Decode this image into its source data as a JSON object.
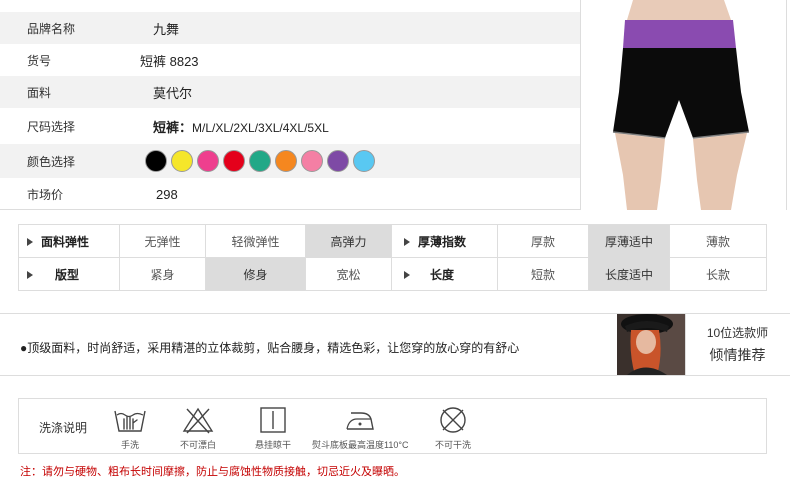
{
  "product": {
    "rows": [
      {
        "label": "品牌名称",
        "value": "九舞"
      },
      {
        "label": "货号",
        "value": "短裤 8823"
      },
      {
        "label": "面料",
        "value": "莫代尔"
      },
      {
        "label": "尺码选择",
        "size_prefix": "短裤：",
        "size_list": "M/L/XL/2XL/3XL/4XL/5XL"
      },
      {
        "label": "颜色选择"
      },
      {
        "label": "市场价",
        "value": "298"
      }
    ],
    "colors": [
      "#000000",
      "#f5e62a",
      "#ee3f8e",
      "#e4001b",
      "#22a887",
      "#f5871f",
      "#f47fa4",
      "#7e4aa5",
      "#59c8f2"
    ]
  },
  "attributes": {
    "row1": {
      "elastic_head": "面料弹性",
      "elastic_options": [
        "无弹性",
        "轻微弹性",
        "高弹力"
      ],
      "elastic_selected": 2,
      "thickness_head": "厚薄指数",
      "thickness_options": [
        "厚款",
        "厚薄适中",
        "薄款"
      ],
      "thickness_selected": 1
    },
    "row2": {
      "fit_head": "版型",
      "fit_options": [
        "紧身",
        "修身",
        "宽松"
      ],
      "fit_selected": 1,
      "length_head": "长度",
      "length_options": [
        "短款",
        "长度适中",
        "长款"
      ],
      "length_selected": 1
    }
  },
  "band": {
    "slogan": "●顶级面料，时尚舒适，采用精湛的立体裁剪，贴合腰身，精选色彩，让您穿的放心穿的有舒心",
    "designer_line1": "10位选款师",
    "designer_line2": "倾情推荐"
  },
  "wash": {
    "title": "洗涤说明",
    "items": [
      {
        "icon": "hand-wash-icon",
        "label": "手洗"
      },
      {
        "icon": "no-bleach-icon",
        "label": "不可漂白"
      },
      {
        "icon": "hang-dry-icon",
        "label": "悬挂晾干"
      },
      {
        "icon": "iron-icon",
        "label": "熨斗底板最高温度110°C"
      },
      {
        "icon": "no-dry-clean-icon",
        "label": "不可干洗"
      }
    ]
  },
  "note": "注：请勿与硬物、粗布长时间摩擦，防止与腐蚀性物质接触，切忌近火及曝晒。"
}
